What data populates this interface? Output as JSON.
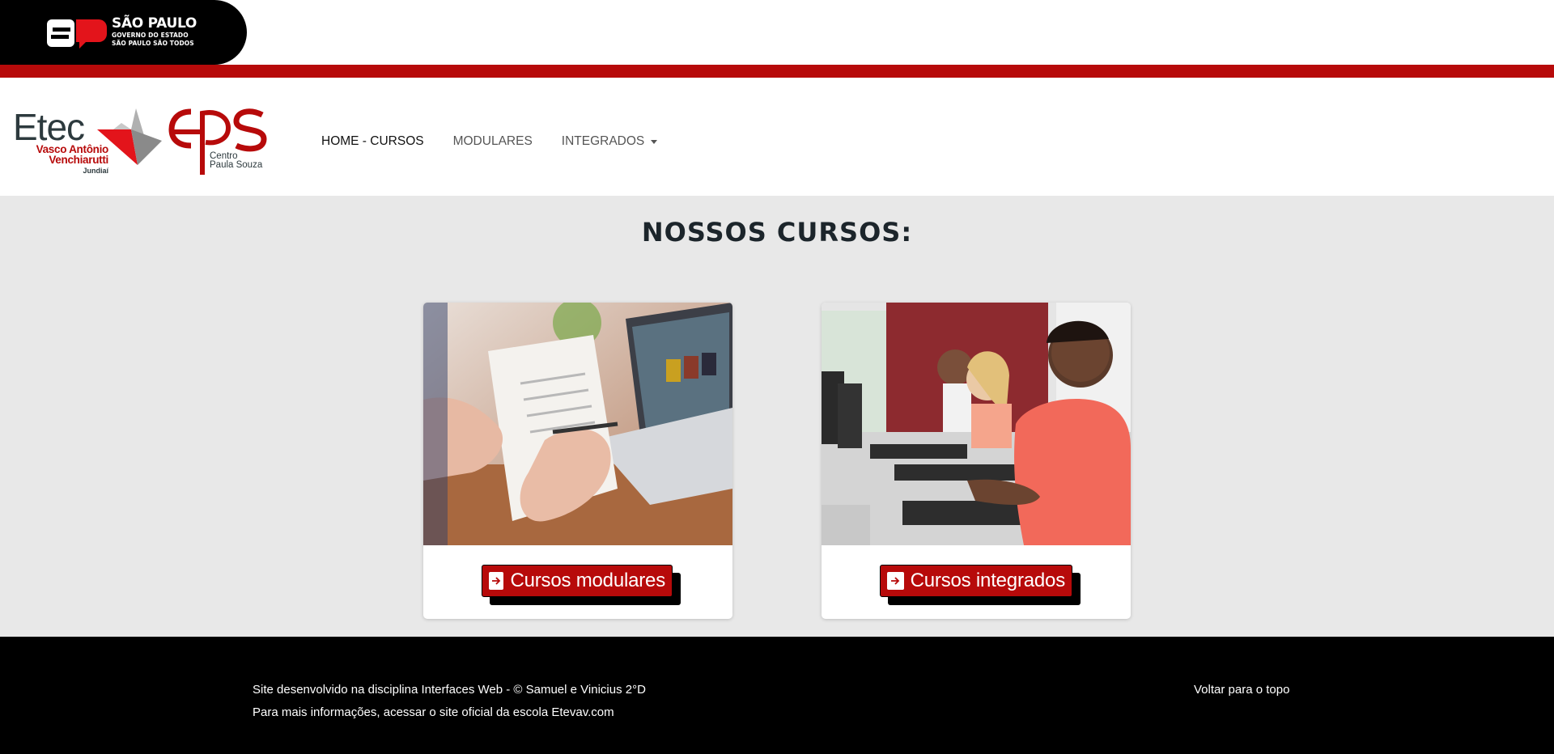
{
  "gov_banner": {
    "title": "SÃO PAULO",
    "subtitle_1": "GOVERNO DO ESTADO",
    "subtitle_2": "SÃO PAULO SÃO TODOS",
    "brand_color": "#b70a0a"
  },
  "header": {
    "etec_logo": {
      "word": "Etec",
      "name_1": "Vasco Antônio",
      "name_2": "Venchiarutti",
      "city": "Jundiaí"
    },
    "cps_logo": {
      "line_1": "Centro",
      "line_2": "Paula Souza"
    },
    "nav": [
      {
        "label": "HOME - CURSOS"
      },
      {
        "label": "MODULARES"
      },
      {
        "label": "INTEGRADOS"
      }
    ]
  },
  "main": {
    "title": "NOSSOS CURSOS:",
    "cards": [
      {
        "image": "laptop-document-photo",
        "button_label": "Cursos modulares",
        "icon": "arrow-right-icon"
      },
      {
        "image": "children-computer-lab-photo",
        "button_label": "Cursos integrados",
        "icon": "arrow-right-icon"
      }
    ]
  },
  "footer": {
    "line_1": "Site desenvolvido na disciplina Interfaces Web - © Samuel e Vinicius 2°D",
    "line_2_prefix": "Para mais informações, acessar o site oficial da escola ",
    "line_2_link": "Etevav.com",
    "back_to_top": "Voltar para o topo"
  }
}
